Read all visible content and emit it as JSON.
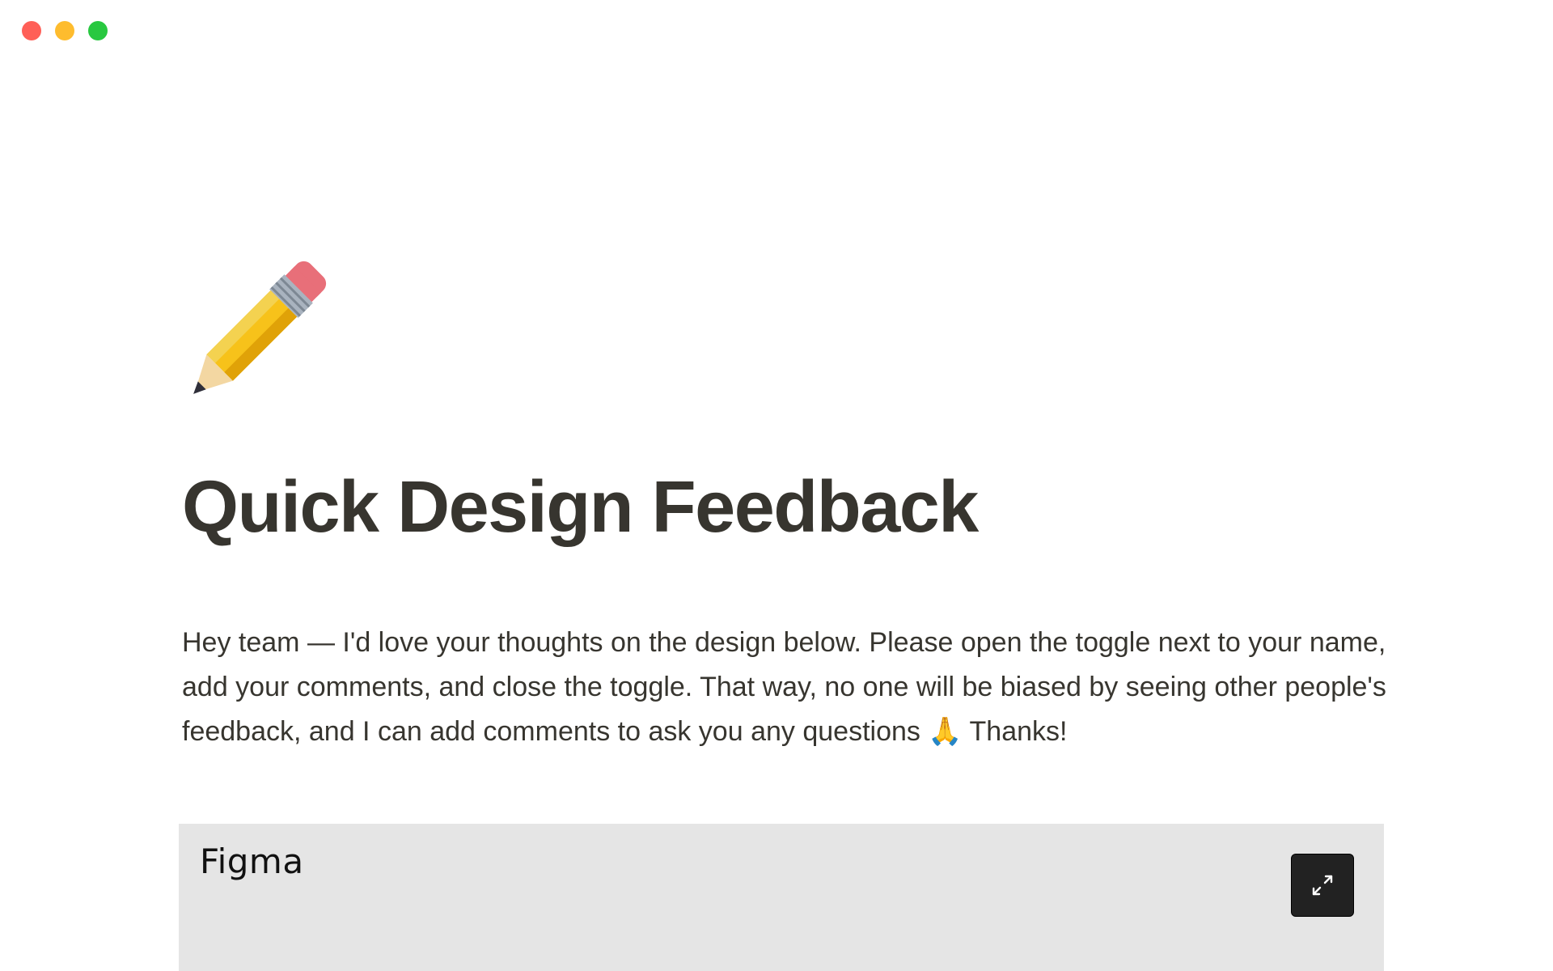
{
  "window": {
    "controls": [
      "close",
      "minimize",
      "zoom"
    ]
  },
  "page": {
    "icon": "pencil-icon",
    "title": "Quick Design Feedback",
    "intro_text": "Hey team — I'd love your thoughts on the design below. Please open the toggle next to your name, add your comments, and close the toggle. That way, no one will be biased by seeing other people's feedback, and I can add comments to ask you any questions",
    "intro_emoji": "🙏",
    "intro_suffix": " Thanks!"
  },
  "embed": {
    "label": "Figma",
    "expand_icon": "expand-icon",
    "background": "#e5e5e5"
  },
  "colors": {
    "text": "#37352f",
    "close": "#ff5f57",
    "minimize": "#febc2e",
    "zoom": "#28c840"
  }
}
